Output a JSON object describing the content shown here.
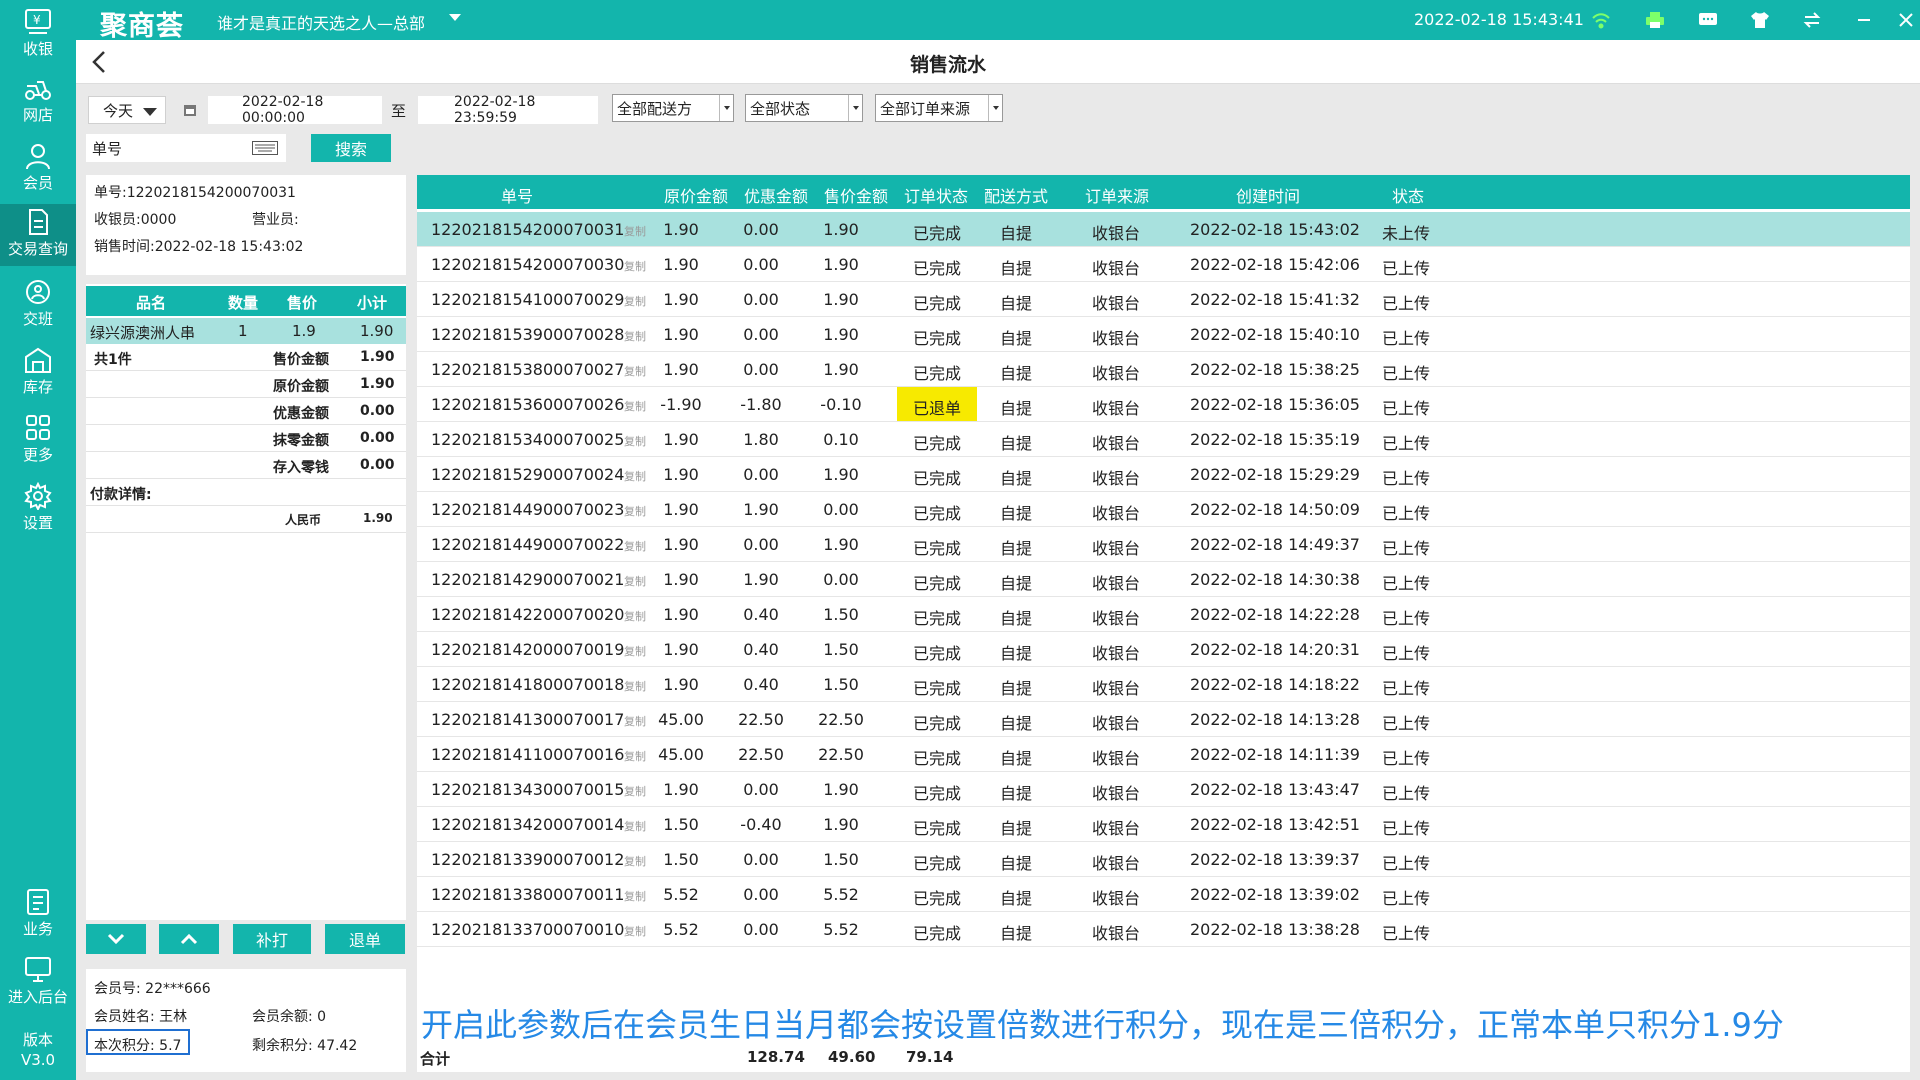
{
  "titlebar": {
    "logo": "聚商荟",
    "store": "谁才是真正的天选之人—总部",
    "datetime": "2022-02-18 15:43:41"
  },
  "nav": {
    "items": [
      {
        "label": "收银",
        "icon": "cash-register-icon"
      },
      {
        "label": "网店",
        "icon": "delivery-icon"
      },
      {
        "label": "会员",
        "icon": "member-icon"
      },
      {
        "label": "交易查询",
        "icon": "transaction-icon"
      },
      {
        "label": "交班",
        "icon": "shift-icon"
      },
      {
        "label": "库存",
        "icon": "warehouse-icon"
      },
      {
        "label": "更多",
        "icon": "grid-icon"
      },
      {
        "label": "设置",
        "icon": "gear-icon"
      },
      {
        "label": "业务",
        "icon": "business-icon"
      },
      {
        "label": "进入后台",
        "icon": "backend-icon"
      }
    ],
    "version_label": "版本",
    "version": "V3.0"
  },
  "header": {
    "title": "销售流水"
  },
  "filters": {
    "period": "今天",
    "start": "2022-02-18 00:00:00",
    "to": "至",
    "end": "2022-02-18 23:59:59",
    "delivery": "全部配送方",
    "status": "全部状态",
    "source": "全部订单来源",
    "order_no_placeholder": "单号",
    "search": "搜索"
  },
  "detail": {
    "order_no": "单号:1220218154200070031",
    "cashier": "收银员:0000",
    "salesperson": "营业员:",
    "sale_time": "销售时间:2022-02-18 15:43:02",
    "item_headers": [
      "品名",
      "数量",
      "售价",
      "小计"
    ],
    "item": {
      "name": "绿兴源澳洲人串",
      "qty": "1",
      "price": "1.9",
      "subtotal": "1.90"
    },
    "count": "共1件",
    "summary": [
      {
        "label": "售价金额",
        "value": "1.90"
      },
      {
        "label": "原价金额",
        "value": "1.90"
      },
      {
        "label": "优惠金额",
        "value": "0.00"
      },
      {
        "label": "抹零金额",
        "value": "0.00"
      },
      {
        "label": "存入零钱",
        "value": "0.00"
      }
    ],
    "payment_title": "付款详情:",
    "payment": {
      "method": "人民币",
      "amount": "1.90"
    }
  },
  "actions": {
    "reprint": "补打",
    "refund": "退单"
  },
  "member": {
    "no": "会员号:  22***666",
    "name": "会员姓名:  王林",
    "balance": "会员余额:  0",
    "points_this": "本次积分:  5.7",
    "points_left": "剩余积分:  47.42"
  },
  "table": {
    "headers": [
      "单号",
      "原价金额",
      "优惠金额",
      "售价金额",
      "订单状态",
      "配送方式",
      "订单来源",
      "创建时间",
      "状态"
    ],
    "copy_label": "复制",
    "rows": [
      [
        "1220218154200070031",
        "1.90",
        "0.00",
        "1.90",
        "已完成",
        "自提",
        "收银台",
        "2022-02-18 15:43:02",
        "未上传"
      ],
      [
        "1220218154200070030",
        "1.90",
        "0.00",
        "1.90",
        "已完成",
        "自提",
        "收银台",
        "2022-02-18 15:42:06",
        "已上传"
      ],
      [
        "1220218154100070029",
        "1.90",
        "0.00",
        "1.90",
        "已完成",
        "自提",
        "收银台",
        "2022-02-18 15:41:32",
        "已上传"
      ],
      [
        "1220218153900070028",
        "1.90",
        "0.00",
        "1.90",
        "已完成",
        "自提",
        "收银台",
        "2022-02-18 15:40:10",
        "已上传"
      ],
      [
        "1220218153800070027",
        "1.90",
        "0.00",
        "1.90",
        "已完成",
        "自提",
        "收银台",
        "2022-02-18 15:38:25",
        "已上传"
      ],
      [
        "1220218153600070026",
        "-1.90",
        "-1.80",
        "-0.10",
        "已退单",
        "自提",
        "收银台",
        "2022-02-18 15:36:05",
        "已上传"
      ],
      [
        "1220218153400070025",
        "1.90",
        "1.80",
        "0.10",
        "已完成",
        "自提",
        "收银台",
        "2022-02-18 15:35:19",
        "已上传"
      ],
      [
        "1220218152900070024",
        "1.90",
        "0.00",
        "1.90",
        "已完成",
        "自提",
        "收银台",
        "2022-02-18 15:29:29",
        "已上传"
      ],
      [
        "1220218144900070023",
        "1.90",
        "1.90",
        "0.00",
        "已完成",
        "自提",
        "收银台",
        "2022-02-18 14:50:09",
        "已上传"
      ],
      [
        "1220218144900070022",
        "1.90",
        "0.00",
        "1.90",
        "已完成",
        "自提",
        "收银台",
        "2022-02-18 14:49:37",
        "已上传"
      ],
      [
        "1220218142900070021",
        "1.90",
        "1.90",
        "0.00",
        "已完成",
        "自提",
        "收银台",
        "2022-02-18 14:30:38",
        "已上传"
      ],
      [
        "1220218142200070020",
        "1.90",
        "0.40",
        "1.50",
        "已完成",
        "自提",
        "收银台",
        "2022-02-18 14:22:28",
        "已上传"
      ],
      [
        "1220218142000070019",
        "1.90",
        "0.40",
        "1.50",
        "已完成",
        "自提",
        "收银台",
        "2022-02-18 14:20:31",
        "已上传"
      ],
      [
        "1220218141800070018",
        "1.90",
        "0.40",
        "1.50",
        "已完成",
        "自提",
        "收银台",
        "2022-02-18 14:18:22",
        "已上传"
      ],
      [
        "1220218141300070017",
        "45.00",
        "22.50",
        "22.50",
        "已完成",
        "自提",
        "收银台",
        "2022-02-18 14:13:28",
        "已上传"
      ],
      [
        "1220218141100070016",
        "45.00",
        "22.50",
        "22.50",
        "已完成",
        "自提",
        "收银台",
        "2022-02-18 14:11:39",
        "已上传"
      ],
      [
        "1220218134300070015",
        "1.90",
        "0.00",
        "1.90",
        "已完成",
        "自提",
        "收银台",
        "2022-02-18 13:43:47",
        "已上传"
      ],
      [
        "1220218134200070014",
        "1.50",
        "-0.40",
        "1.90",
        "已完成",
        "自提",
        "收银台",
        "2022-02-18 13:42:51",
        "已上传"
      ],
      [
        "1220218133900070012",
        "1.50",
        "0.00",
        "1.50",
        "已完成",
        "自提",
        "收银台",
        "2022-02-18 13:39:37",
        "已上传"
      ],
      [
        "1220218133800070011",
        "5.52",
        "0.00",
        "5.52",
        "已完成",
        "自提",
        "收银台",
        "2022-02-18 13:39:02",
        "已上传"
      ],
      [
        "1220218133700070010",
        "5.52",
        "0.00",
        "5.52",
        "已完成",
        "自提",
        "收银台",
        "2022-02-18 13:38:28",
        "已上传"
      ]
    ],
    "highlight_color": "#f7ea00"
  },
  "note": "开启此参数后在会员生日当月都会按设置倍数进行积分，现在是三倍积分，正常本单只积分1.9分",
  "totals": {
    "label": "合计",
    "original": "128.74",
    "discount": "49.60",
    "sale": "79.14"
  }
}
